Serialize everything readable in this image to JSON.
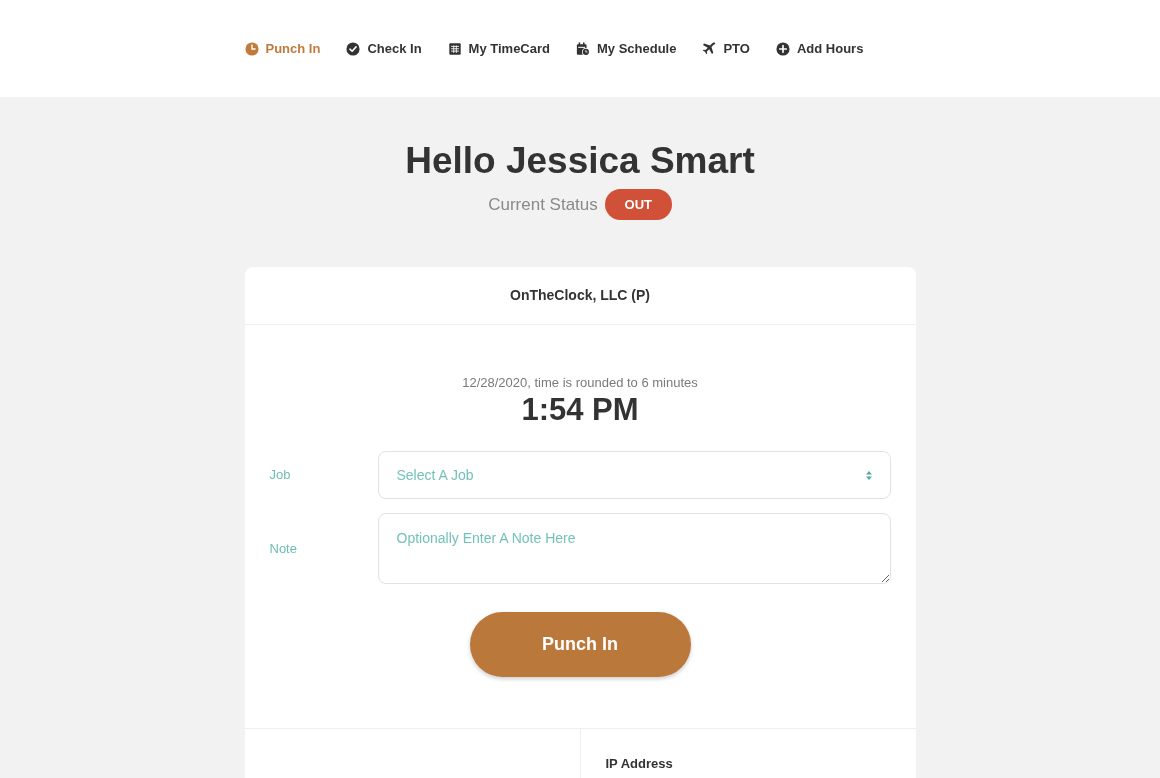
{
  "nav": [
    {
      "label": "Punch In",
      "selected": true
    },
    {
      "label": "Check In",
      "selected": false
    },
    {
      "label": "My TimeCard",
      "selected": false
    },
    {
      "label": "My Schedule",
      "selected": false
    },
    {
      "label": "PTO",
      "selected": false
    },
    {
      "label": "Add Hours",
      "selected": false
    }
  ],
  "greeting": "Hello Jessica Smart",
  "status": {
    "label": "Current Status",
    "badge": "OUT"
  },
  "card": {
    "company": "OnTheClock, LLC (P)",
    "date_note": "12/28/2020, time is rounded to 6 minutes",
    "time": "1:54 PM",
    "fields": [
      {
        "kind": "select",
        "label": "Job",
        "placeholder": "Select A Job"
      },
      {
        "kind": "textarea",
        "label": "Note",
        "placeholder": "Optionally Enter A Note Here"
      }
    ],
    "button": "Punch In",
    "details": [
      {
        "heading": "IP Address"
      }
    ]
  }
}
